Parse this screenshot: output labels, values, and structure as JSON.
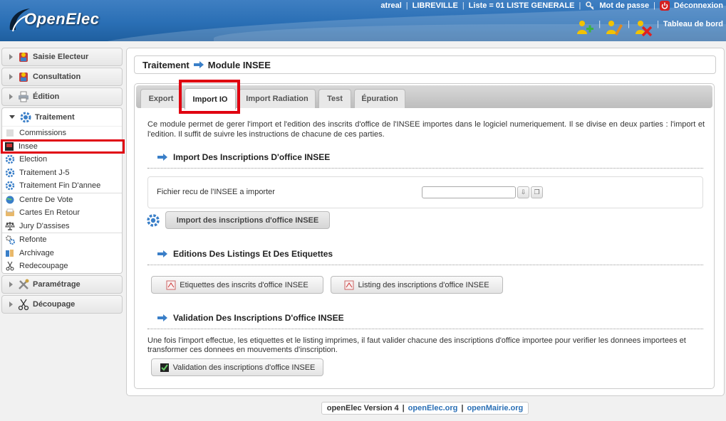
{
  "header": {
    "logo_text": "OpenElec",
    "user": "atreal",
    "city": "LIBREVILLE",
    "liste": "Liste = 01 LISTE GENERALE",
    "password_link": "Mot de passe",
    "logout_link": "Déconnexion",
    "dashboard_link": "Tableau de bord",
    "separator": "|"
  },
  "sidebar": {
    "sections": [
      {
        "label": "Saisie Electeur"
      },
      {
        "label": "Consultation"
      },
      {
        "label": "Édition"
      },
      {
        "label": "Traitement"
      },
      {
        "label": "Paramétrage"
      },
      {
        "label": "Découpage"
      }
    ],
    "traitement_items": [
      {
        "label": "Commissions"
      },
      {
        "label": "Insee"
      },
      {
        "label": "Election"
      },
      {
        "label": "Traitement J-5"
      },
      {
        "label": "Traitement Fin D'annee"
      },
      {
        "label": "Centre De Vote"
      },
      {
        "label": "Cartes En Retour"
      },
      {
        "label": "Jury D'assises"
      },
      {
        "label": "Refonte"
      },
      {
        "label": "Archivage"
      },
      {
        "label": "Redecoupage"
      }
    ]
  },
  "main": {
    "breadcrumb_parent": "Traitement",
    "breadcrumb_current": "Module INSEE",
    "tabs": [
      {
        "label": "Export"
      },
      {
        "label": "Import IO"
      },
      {
        "label": "Import Radiation"
      },
      {
        "label": "Test"
      },
      {
        "label": "Épuration"
      }
    ],
    "intro": "Ce module permet de gerer l'import et l'edition des inscrits d'office de l'INSEE importes dans le logiciel numeriquement. Il se divise en deux parties : l'import et l'edition. Il suffit de suivre les instructions de chacune de ces parties.",
    "section1_title": "Import Des Inscriptions D'office INSEE",
    "file_label": "Fichier recu de l'INSEE a importer",
    "import_button": "Import des inscriptions d'office INSEE",
    "section2_title": "Editions Des Listings Et Des Etiquettes",
    "labels_button": "Etiquettes des inscrits d'office INSEE",
    "listing_button": "Listing des inscriptions d'office INSEE",
    "section3_title": "Validation Des Inscriptions D'office INSEE",
    "validation_text": "Une fois l'import effectue, les etiquettes et le listing imprimes, il faut valider chacune des inscriptions d'office importee pour verifier les donnees importees et transformer ces donnees en mouvements d'inscription.",
    "validation_button": "Validation des inscriptions d'office INSEE"
  },
  "footer": {
    "version": "openElec Version 4",
    "link1": "openElec.org",
    "link2": "openMairie.org",
    "separator": "|"
  },
  "colors": {
    "header_blue": "#2a6fb5",
    "highlight_red": "#e00010",
    "arrow_blue": "#3a7fc8"
  }
}
